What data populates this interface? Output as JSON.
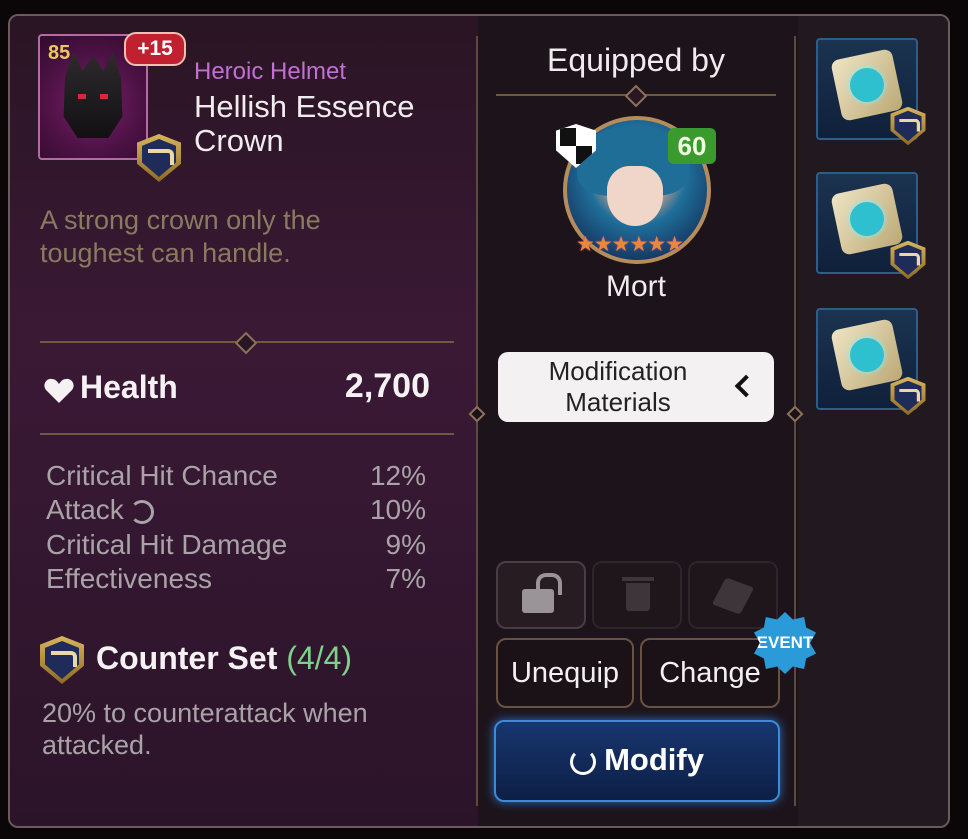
{
  "item": {
    "enhance_level": "+15",
    "item_level": "85",
    "type": "Heroic Helmet",
    "name": "Hellish Essence Crown",
    "description": "A strong crown only the toughest can handle."
  },
  "main_stat": {
    "label": "Health",
    "value": "2,700"
  },
  "sub_stats": [
    {
      "name": "Critical Hit Chance",
      "value": "12%"
    },
    {
      "name": "Attack",
      "value": "10%"
    },
    {
      "name": "Critical Hit Damage",
      "value": "9%"
    },
    {
      "name": "Effectiveness",
      "value": "7%"
    }
  ],
  "set": {
    "name": "Counter Set",
    "count": "(4/4)",
    "description": "20% to counterattack when attacked."
  },
  "equipped": {
    "title": "Equipped by",
    "hero_name": "Mort",
    "hero_level": "60",
    "stars": "★★★★★★"
  },
  "buttons": {
    "modification_materials": "Modification Materials",
    "unequip": "Unequip",
    "change": "Change",
    "event_badge": "EVENT",
    "modify": "Modify"
  },
  "colors": {
    "item_type": "#c070d0",
    "set_count": "#7fd08a",
    "description": "#8a7a60",
    "accent_blue": "#3d8bd8"
  }
}
